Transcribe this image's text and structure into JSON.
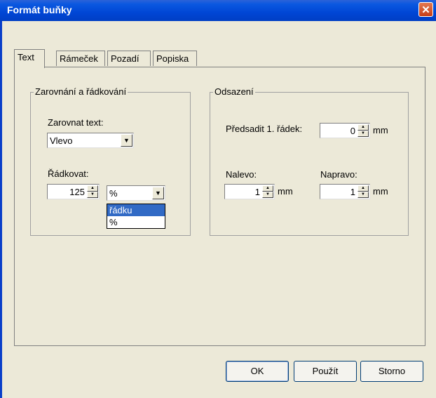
{
  "window": {
    "title": "Formát buňky",
    "close_glyph": "✕"
  },
  "tabs": [
    {
      "label": "Text",
      "active": true
    },
    {
      "label": "Rámeček",
      "active": false
    },
    {
      "label": "Pozadí",
      "active": false
    },
    {
      "label": "Popiska",
      "active": false
    }
  ],
  "alignment": {
    "group_title": "Zarovnání a řádkování",
    "align_label": "Zarovnat text:",
    "align_value": "Vlevo",
    "spacing_label": "Řádkovat:",
    "spacing_value": "125",
    "unit_value": "%",
    "unit_options": [
      "řádku",
      "%"
    ],
    "unit_selected_index": 0
  },
  "indent": {
    "group_title": "Odsazení",
    "first_line_label": "Předsadit 1. řádek:",
    "first_line_value": "0",
    "first_line_unit": "mm",
    "left_label": "Nalevo:",
    "left_value": "1",
    "left_unit": "mm",
    "right_label": "Napravo:",
    "right_value": "1",
    "right_unit": "mm"
  },
  "buttons": {
    "ok": "OK",
    "apply": "Použít",
    "cancel": "Storno"
  },
  "icons": {
    "dropdown_arrow": "▼",
    "spin_up": "▲",
    "spin_down": "▼"
  }
}
